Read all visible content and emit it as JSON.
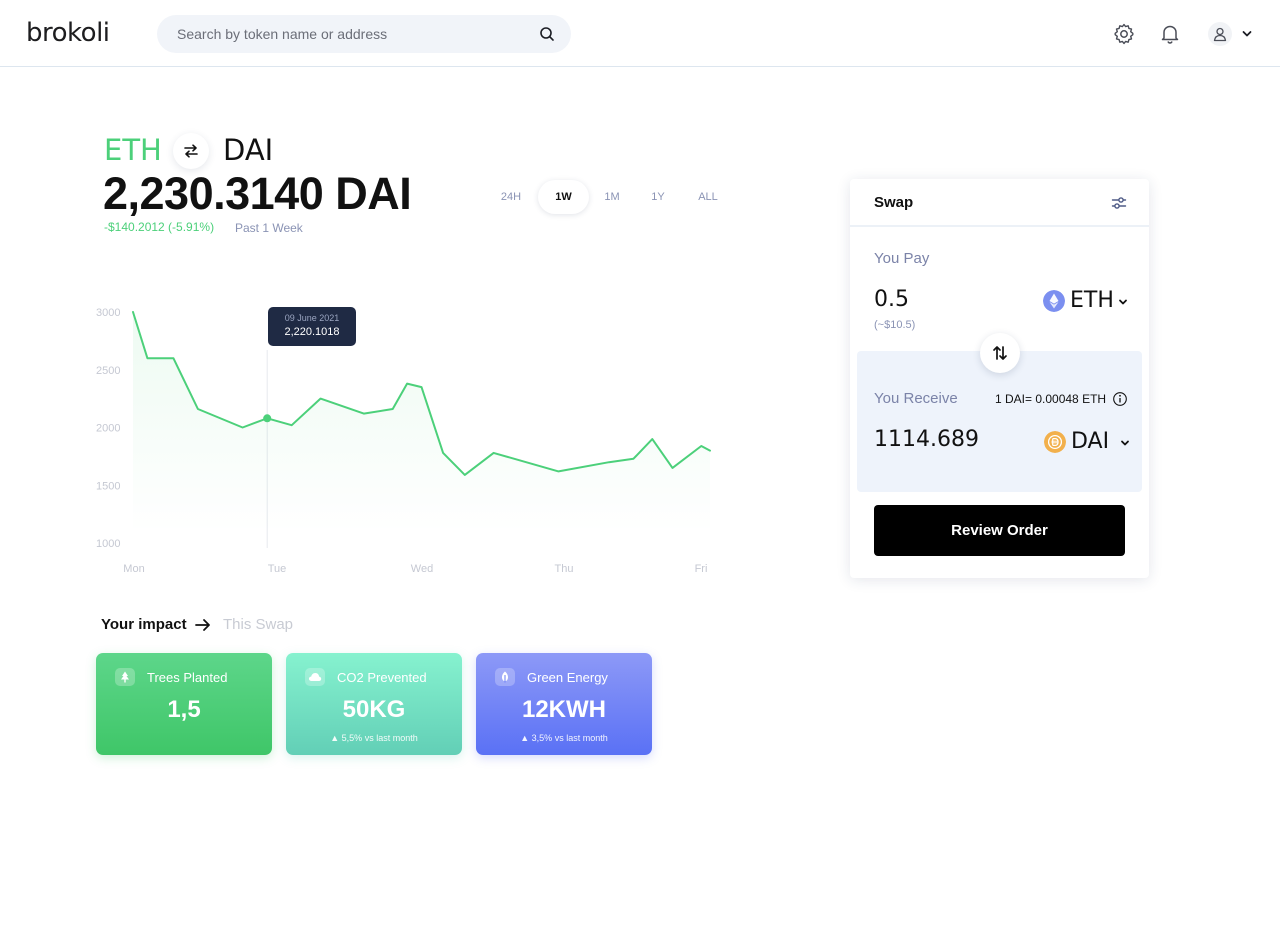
{
  "header": {
    "logo": "brokoli",
    "search": {
      "placeholder": "Search by token name or address",
      "value": ""
    },
    "icons": [
      "gear-icon",
      "bell-icon",
      "user-icon",
      "chevron-down-icon"
    ]
  },
  "pair": {
    "base": "ETH",
    "quote": "DAI",
    "price": "2,230.3140 DAI",
    "change": "-$140.2012 (-5.91%)",
    "period": "Past 1 Week"
  },
  "ranges": [
    {
      "label": "24H",
      "active": false
    },
    {
      "label": "1W",
      "active": true
    },
    {
      "label": "1M",
      "active": false
    },
    {
      "label": "1Y",
      "active": false
    },
    {
      "label": "ALL",
      "active": false
    }
  ],
  "tooltip": {
    "date": "09 June 2021",
    "value": "2,220.1018"
  },
  "chart_data": {
    "type": "area",
    "title": "",
    "xlabel": "",
    "ylabel": "",
    "categories": [
      "Mon",
      "Tue",
      "Wed",
      "Thu",
      "Fri"
    ],
    "y_ticks": [
      "3000",
      "2500",
      "2000",
      "1500",
      "1000"
    ],
    "ylim": [
      1000,
      3000
    ],
    "xlim": [
      0,
      4
    ],
    "grid": false,
    "x": [
      0,
      0.1,
      0.28,
      0.45,
      0.76,
      0.93,
      1.1,
      1.3,
      1.6,
      1.8,
      1.9,
      2.0,
      2.15,
      2.3,
      2.5,
      2.95,
      3.3,
      3.47,
      3.6,
      3.74,
      3.94,
      4.0
    ],
    "y": [
      3000,
      2600,
      2600,
      2160,
      2000,
      2080,
      2020,
      2250,
      2120,
      2160,
      2380,
      2350,
      1780,
      1590,
      1780,
      1620,
      1700,
      1730,
      1900,
      1650,
      1840,
      1800
    ],
    "series": [
      {
        "values": [
          3000,
          2600,
          2600,
          2160,
          2000,
          2080,
          2020,
          2250,
          2120,
          2160,
          2380,
          2350,
          1780,
          1590,
          1780,
          1620,
          1700,
          1730,
          1900,
          1650,
          1840,
          1800
        ]
      }
    ],
    "highlight": {
      "x": 0.93,
      "y": 2080
    },
    "colors": {
      "line": "#4cd07a",
      "fill": "#4cd07a",
      "tick": "#c5c8d2",
      "crosshair": "#e6e9ee"
    }
  },
  "impact": {
    "title": "Your impact",
    "swap_tab": "This Swap",
    "cards": [
      {
        "title": "Trees Planted",
        "value": "1,5",
        "note": "",
        "icon": "tree-icon"
      },
      {
        "title": "CO2 Prevented",
        "value": "50KG",
        "note": "▲ 5,5% vs last month",
        "icon": "cloud-icon"
      },
      {
        "title": "Green Energy",
        "value": "12KWH",
        "note": "▲ 3,5% vs last month",
        "icon": "leaf-icon"
      }
    ]
  },
  "swap": {
    "title": "Swap",
    "pay": {
      "label": "You Pay",
      "amount": "0.5",
      "usd": "(~$10.5)",
      "token": "ETH"
    },
    "receive": {
      "label": "You Receive",
      "amount": "1114.689",
      "token": "DAI",
      "rate": "1 DAI= 0.00048 ETH"
    },
    "button": "Review Order",
    "colors": {
      "eth": "#7b8ff0",
      "dai": "#f2b04c"
    }
  }
}
